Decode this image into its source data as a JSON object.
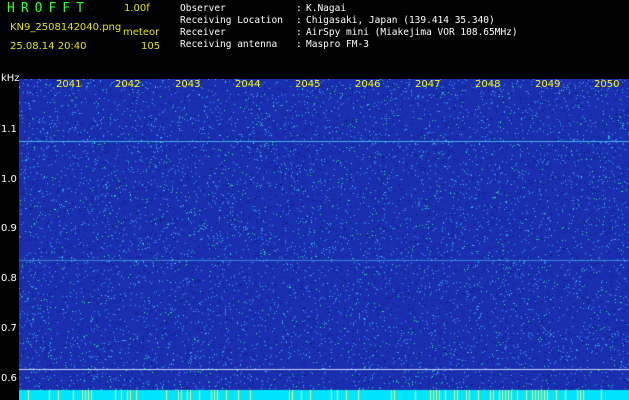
{
  "header": {
    "app_title": "HROFFT",
    "version": "1.00f",
    "filename": "KN9_2508142040.png",
    "meteor_label": "meteor",
    "datetime": "25.08.14 20:40",
    "meteor_count": "105"
  },
  "station": {
    "rows": [
      {
        "key": "Observer",
        "value": "K.Nagai"
      },
      {
        "key": "Receiving Location",
        "value": "Chigasaki, Japan (139.414 35.340)"
      },
      {
        "key": "Receiver",
        "value": "AirSpy mini (Miakejima VOR 108.65MHz)"
      },
      {
        "key": "Receiving antenna",
        "value": "Maspro FM-3"
      }
    ],
    "separator": ":"
  },
  "plot": {
    "y_unit": "kHz",
    "y_ticks": [
      "1.1",
      "1.0",
      "0.9",
      "0.8",
      "0.7",
      "0.6"
    ],
    "x_ticks": [
      "2041",
      "2042",
      "2043",
      "2044",
      "2045",
      "2046",
      "2047",
      "2048",
      "2049",
      "2050"
    ],
    "colors": {
      "background": "#1a2fb0",
      "noise_dark": "#0a1870",
      "noise_light": "#3aa8ff",
      "noise_hot": "#33ff99",
      "tick_labels": "#ffff00",
      "bottom_band": "#00e5ff"
    }
  }
}
